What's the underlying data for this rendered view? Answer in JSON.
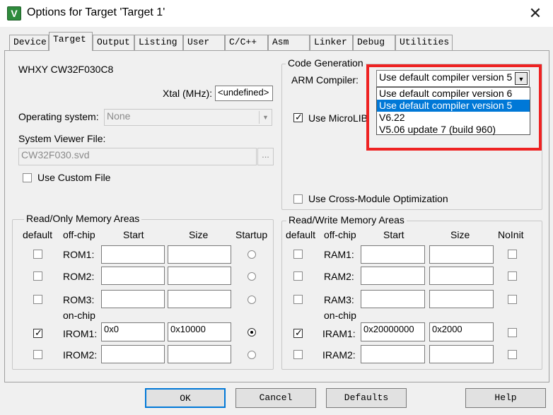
{
  "window": {
    "title": "Options for Target 'Target 1'",
    "close_glyph": "✕",
    "icon_letter": "V"
  },
  "tabs": [
    {
      "label": "Device"
    },
    {
      "label": "Target"
    },
    {
      "label": "Output"
    },
    {
      "label": "Listing"
    },
    {
      "label": "User"
    },
    {
      "label": "C/C++"
    },
    {
      "label": "Asm"
    },
    {
      "label": "Linker"
    },
    {
      "label": "Debug"
    },
    {
      "label": "Utilities"
    }
  ],
  "target": {
    "device_name": "WHXY CW32F030C8",
    "xtal_label": "Xtal (MHz):",
    "xtal_value": "<undefined>",
    "os_label": "Operating system:",
    "os_value": "None",
    "svd_label": "System Viewer File:",
    "svd_value": "CW32F030.svd",
    "browse_label": "...",
    "custom_file_label": "Use Custom File"
  },
  "codegen": {
    "title": "Code Generation",
    "arm_compiler_label": "ARM Compiler:",
    "compiler_value": "Use default compiler version 5",
    "options": [
      "Use default compiler version 6",
      "Use default compiler version 5",
      "V6.22",
      "V5.06 update 7 (build 960)"
    ],
    "microlib_label": "Use MicroLIB",
    "cross_module_label": "Use Cross-Module Optimization"
  },
  "rom": {
    "title": "Read/Only Memory Areas",
    "headers": {
      "default": "default",
      "offchip": "off-chip",
      "start": "Start",
      "size": "Size",
      "startup": "Startup"
    },
    "onchip_label": "on-chip",
    "rows": [
      {
        "name": "ROM1:",
        "start": "",
        "size": ""
      },
      {
        "name": "ROM2:",
        "start": "",
        "size": ""
      },
      {
        "name": "ROM3:",
        "start": "",
        "size": ""
      },
      {
        "name": "IROM1:",
        "start": "0x0",
        "size": "0x10000"
      },
      {
        "name": "IROM2:",
        "start": "",
        "size": ""
      }
    ]
  },
  "ram": {
    "title": "Read/Write Memory Areas",
    "headers": {
      "default": "default",
      "offchip": "off-chip",
      "start": "Start",
      "size": "Size",
      "noinit": "NoInit"
    },
    "onchip_label": "on-chip",
    "rows": [
      {
        "name": "RAM1:",
        "start": "",
        "size": ""
      },
      {
        "name": "RAM2:",
        "start": "",
        "size": ""
      },
      {
        "name": "RAM3:",
        "start": "",
        "size": ""
      },
      {
        "name": "IRAM1:",
        "start": "0x20000000",
        "size": "0x2000"
      },
      {
        "name": "IRAM2:",
        "start": "",
        "size": ""
      }
    ]
  },
  "buttons": {
    "ok": "OK",
    "cancel": "Cancel",
    "defaults": "Defaults",
    "help": "Help"
  },
  "check_glyph": "✓",
  "combo_arrow": "▼",
  "colors": {
    "highlight_box": "#ee2222",
    "selection": "#0078d7"
  }
}
